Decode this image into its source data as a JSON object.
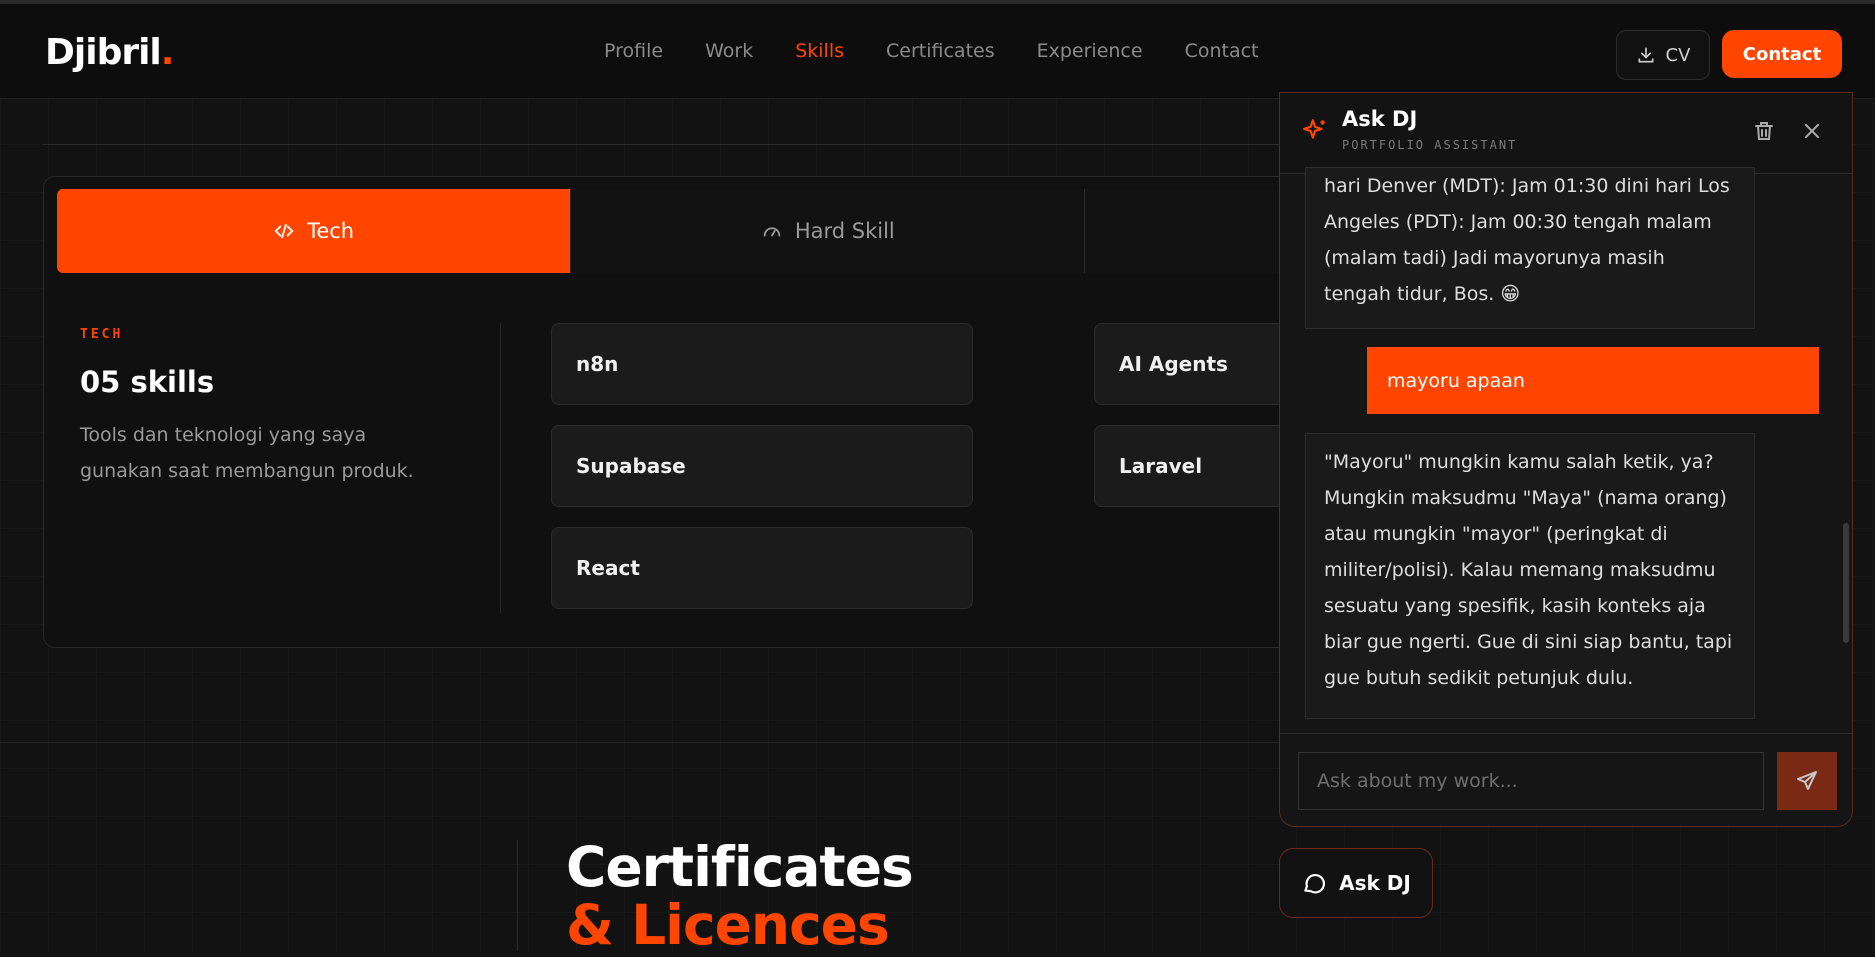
{
  "logo": {
    "text": "Djibril",
    "dot": "."
  },
  "nav": {
    "links": [
      "Profile",
      "Work",
      "Skills",
      "Certificates",
      "Experience",
      "Contact"
    ],
    "active": "Skills",
    "cv_label": "CV",
    "contact_label": "Contact"
  },
  "skills": {
    "tabs": [
      {
        "label": "Tech",
        "icon": "code-icon",
        "active": true
      },
      {
        "label": "Hard Skill",
        "icon": "gauge-icon",
        "active": false
      }
    ],
    "category_label": "TECH",
    "count_label": "05 skills",
    "description": "Tools dan teknologi yang saya gunakan saat membangun produk.",
    "items": [
      "n8n",
      "AI Agents",
      "Supabase",
      "Laravel",
      "React"
    ]
  },
  "certificates": {
    "title_line1": "Certificates",
    "title_line2": "& Licences"
  },
  "chat": {
    "title": "Ask DJ",
    "subtitle": "PORTFOLIO ASSISTANT",
    "messages": [
      {
        "role": "bot",
        "text": "hari Denver (MDT): Jam 01:30 dini hari Los Angeles (PDT): Jam 00:30 tengah malam (malam tadi) Jadi mayorunya masih tengah tidur, Bos. 😁"
      },
      {
        "role": "user",
        "text": "mayoru apaan"
      },
      {
        "role": "bot",
        "text": "\"Mayoru\" mungkin kamu salah ketik, ya? Mungkin maksudmu \"Maya\" (nama orang) atau mungkin \"mayor\" (peringkat di militer/polisi). Kalau memang maksudmu sesuatu yang spesifik, kasih konteks aja biar gue ngerti. Gue di sini siap bantu, tapi gue butuh sedikit petunjuk dulu."
      }
    ],
    "input_placeholder": "Ask about my work...",
    "launcher_label": "Ask DJ"
  },
  "colors": {
    "accent": "#ff4500",
    "background": "#121212"
  }
}
